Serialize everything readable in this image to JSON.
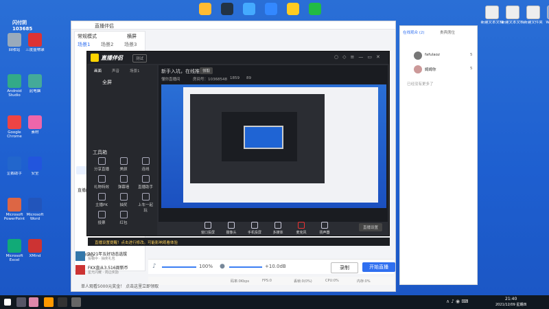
{
  "desktop_icons": [
    {
      "id": "recycle",
      "label": "回收站",
      "color": "#9ab"
    },
    {
      "id": "ps",
      "label": "三度盛物录",
      "color": "#d33"
    },
    {
      "id": "tv",
      "label": "Android Studio",
      "color": "#3a8"
    },
    {
      "id": "folder1",
      "label": "此电脑",
      "color": "#4a9"
    },
    {
      "id": "wps",
      "label": "Google Chrome",
      "color": "#e44"
    },
    {
      "id": "colors",
      "label": "素材",
      "color": "#e6a"
    },
    {
      "id": "blue",
      "label": "企鹅助手",
      "color": "#26c"
    },
    {
      "id": "shield",
      "label": "安全",
      "color": "#25d"
    },
    {
      "id": "ppt",
      "label": "Microsoft PowerPoint",
      "color": "#d64"
    },
    {
      "id": "word",
      "label": "Microsoft Word",
      "color": "#25b"
    },
    {
      "id": "excel",
      "label": "Microsoft Excel",
      "color": "#1a7"
    },
    {
      "id": "x2",
      "label": "XMind",
      "color": "#c33"
    }
  ],
  "ops": {
    "name": "闪付阴",
    "number": "103685"
  },
  "top_icons": [
    {
      "id": "chrome",
      "color": "#fb3"
    },
    {
      "id": "steam",
      "color": "#234"
    },
    {
      "id": "app3",
      "color": "#4af"
    },
    {
      "id": "feishu",
      "color": "#38f"
    },
    {
      "id": "qq",
      "color": "#fc2"
    },
    {
      "id": "wechat",
      "color": "#2b4"
    }
  ],
  "right_desktop": [
    {
      "label": "新建文本文档",
      "color": "#eee"
    },
    {
      "label": "新建文本文档",
      "color": "#eee"
    },
    {
      "label": "新建文件夹",
      "color": "#eee"
    },
    {
      "label": "WPS云盘",
      "color": "#8ad"
    }
  ],
  "win_bg": {
    "title": "直播伴侣",
    "mode": "常规模式",
    "mode_btn": "横屏",
    "scenes": [
      "场景1",
      "场景2",
      "场景3"
    ],
    "activity_title": "活动中心",
    "activity_link": "查看更多",
    "activities": [
      {
        "title": "2021年五好动态选拔",
        "sub": "投稿中 · 抽奖礼包"
      },
      {
        "title": "FKX直从3.516周新币",
        "sub": "星光闪耀 · 周边奖励"
      }
    ],
    "bottom_tip": "单人观看5000元奖金！ 点击这里立即领取",
    "volume_label": "100%",
    "mic_label": "+10.0dB",
    "record_btn": "录制",
    "start_btn": "开始直播",
    "status_items": [
      "码率:0Kbps",
      "FPS:0",
      "丢帧:0(0%)",
      "CPU:0%",
      "内存:0%"
    ],
    "side_tabs": [
      "直播间",
      "工具箱"
    ]
  },
  "win_right": {
    "tabs": [
      "在线观众 (2)",
      "贵宾席位"
    ],
    "users": [
      {
        "name": "fafulaoz",
        "score": "5"
      },
      {
        "name": "姆姆你",
        "score": "5"
      }
    ],
    "empty": "已经没有更多了"
  },
  "win_dark": {
    "title": "直播伴侣",
    "badge": "测试",
    "tabs": [
      "画面",
      "声音",
      "场景1"
    ],
    "source": "全屏",
    "hint_title": "新手入坑，在线推打",
    "hint_btn": "领取",
    "room_label": "懂你直播间",
    "room_id": "房间号：10368548",
    "viewers": "1859",
    "likes": "89",
    "tools": [
      {
        "id": "share",
        "label": "分享直播"
      },
      {
        "id": "beauty",
        "label": "美颜"
      },
      {
        "id": "link",
        "label": "连线"
      },
      {
        "id": "audio",
        "label": "礼物特效"
      },
      {
        "id": "sticker",
        "label": "弹幕墙"
      },
      {
        "id": "assist",
        "label": "直播助手"
      },
      {
        "id": "pk",
        "label": "主播PK"
      },
      {
        "id": "gamble",
        "label": "抽奖"
      },
      {
        "id": "together",
        "label": "上车一起玩"
      },
      {
        "id": "gifts",
        "label": "投票"
      },
      {
        "id": "redpack",
        "label": "红包"
      }
    ],
    "toolbox": "工具箱",
    "controls": [
      {
        "id": "window",
        "label": "窗口投屏"
      },
      {
        "id": "camera",
        "label": "摄像头"
      },
      {
        "id": "phone",
        "label": "手机投屏"
      },
      {
        "id": "media",
        "label": "多媒体"
      },
      {
        "id": "mic",
        "label": "麦克风"
      },
      {
        "id": "speaker",
        "label": "扬声器"
      }
    ],
    "bottom_btn": "直播设置",
    "warning": "直播设置提醒！点击进行修改。可能影响观看体验"
  },
  "clock": {
    "time": "21:40",
    "date": "2021/12/09 星期四"
  }
}
